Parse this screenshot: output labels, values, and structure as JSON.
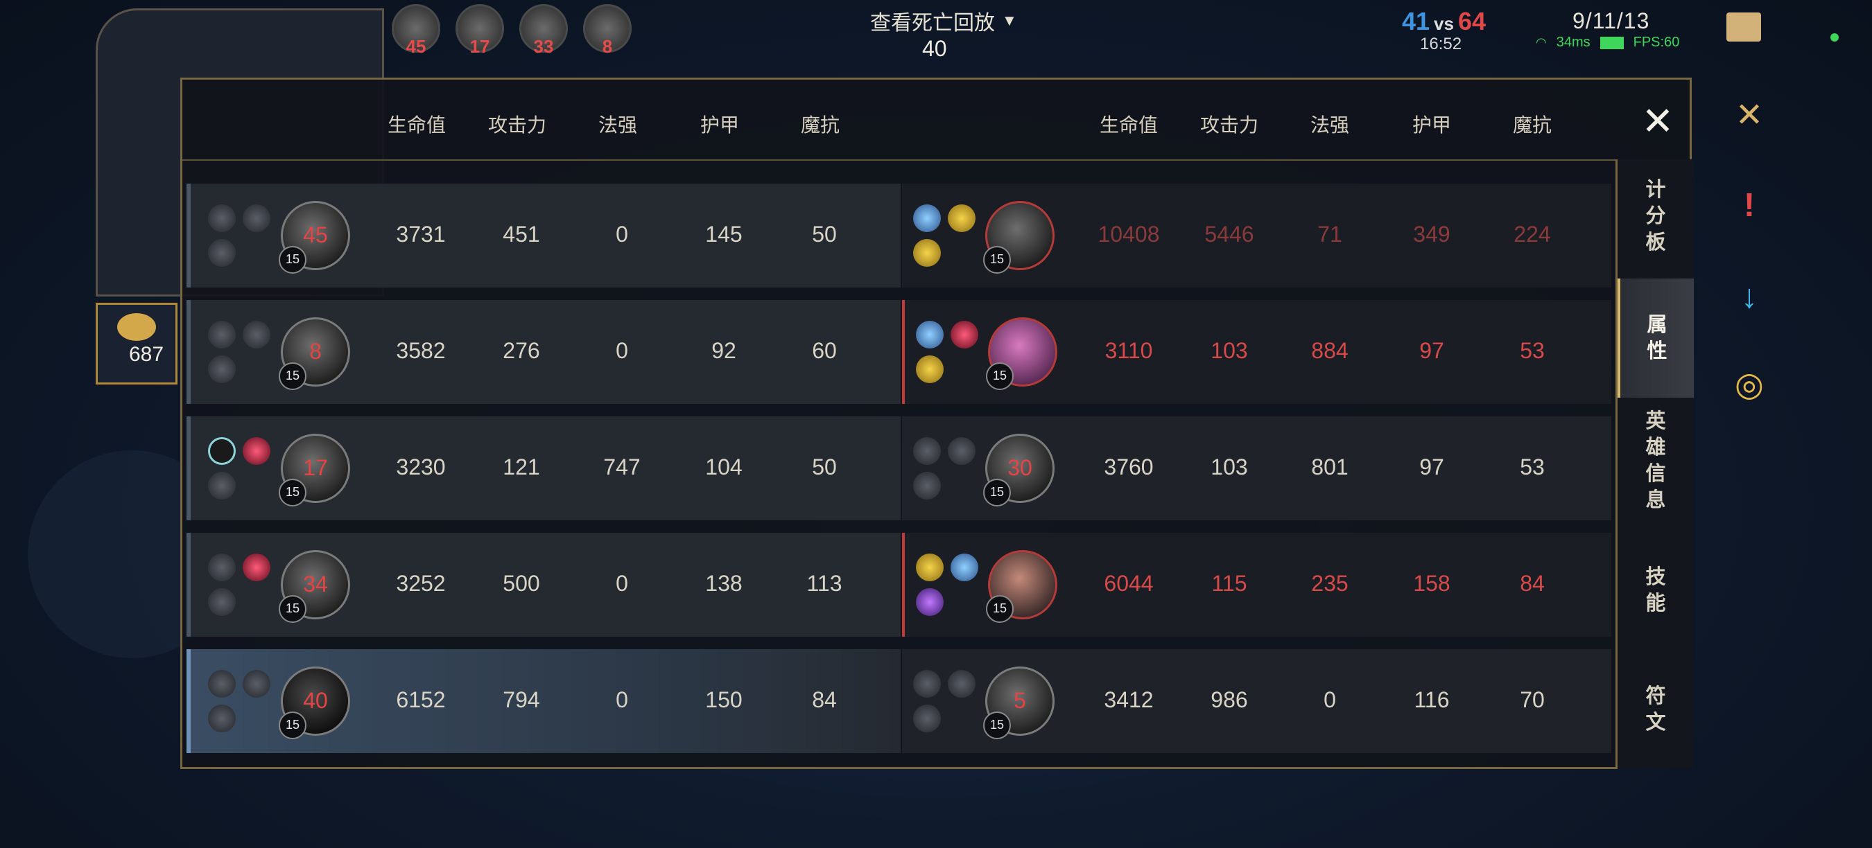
{
  "hud": {
    "title": "查看死亡回放",
    "timer": "40",
    "score_blue": "41",
    "score_vs": "vs",
    "score_red": "64",
    "clock": "16:52",
    "kda": "9/11/13",
    "ping": "34ms",
    "fps": "FPS:60",
    "top_heroes": [
      "45",
      "17",
      "33",
      "8"
    ]
  },
  "gold": "687",
  "columns": [
    "生命值",
    "攻击力",
    "法强",
    "护甲",
    "魔抗"
  ],
  "close_label": "✕",
  "tabs": [
    {
      "label": "计分板",
      "active": false
    },
    {
      "label": "属性",
      "active": true
    },
    {
      "label": "英雄信息",
      "active": false
    },
    {
      "label": "技能",
      "active": false
    },
    {
      "label": "符文",
      "active": false
    }
  ],
  "rows": [
    {
      "left": {
        "kills": "45",
        "level": "15",
        "stats": [
          "3731",
          "451",
          "0",
          "145",
          "50"
        ]
      },
      "right": {
        "kills": "",
        "level": "15",
        "stats": [
          "10408",
          "5446",
          "71",
          "349",
          "224"
        ]
      }
    },
    {
      "left": {
        "kills": "8",
        "level": "15",
        "stats": [
          "3582",
          "276",
          "0",
          "92",
          "60"
        ]
      },
      "right": {
        "kills": "",
        "level": "15",
        "stats": [
          "3110",
          "103",
          "884",
          "97",
          "53"
        ]
      }
    },
    {
      "left": {
        "kills": "17",
        "level": "15",
        "stats": [
          "3230",
          "121",
          "747",
          "104",
          "50"
        ]
      },
      "right": {
        "kills": "30",
        "level": "15",
        "stats": [
          "3760",
          "103",
          "801",
          "97",
          "53"
        ]
      }
    },
    {
      "left": {
        "kills": "34",
        "level": "15",
        "stats": [
          "3252",
          "500",
          "0",
          "138",
          "113"
        ]
      },
      "right": {
        "kills": "",
        "level": "15",
        "stats": [
          "6044",
          "115",
          "235",
          "158",
          "84"
        ]
      }
    },
    {
      "left": {
        "kills": "40",
        "level": "15",
        "stats": [
          "6152",
          "794",
          "0",
          "150",
          "84"
        ]
      },
      "right": {
        "kills": "5",
        "level": "15",
        "stats": [
          "3412",
          "986",
          "0",
          "116",
          "70"
        ]
      }
    }
  ],
  "colors": {
    "blue_team": "#3f93e0",
    "red_team": "#e04848",
    "gold_border": "#786640"
  }
}
